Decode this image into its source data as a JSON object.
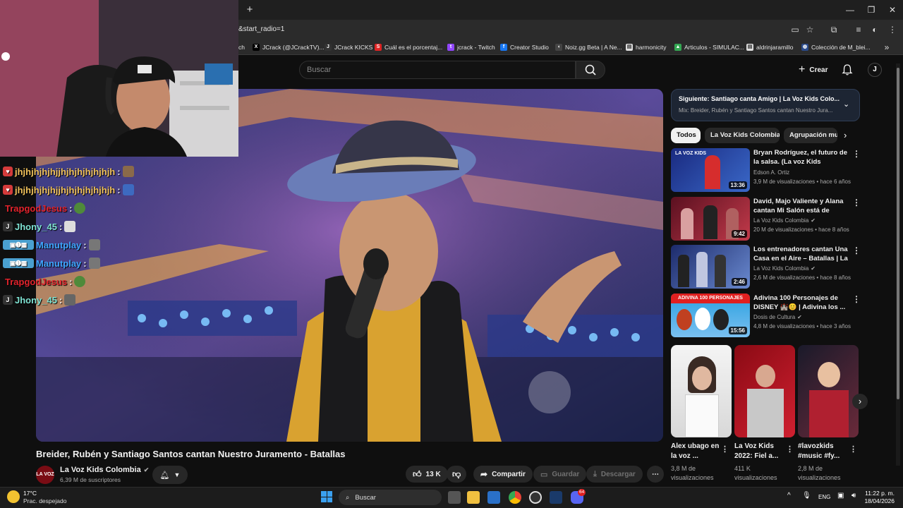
{
  "browser": {
    "url": "&start_radio=1",
    "bookmarks": [
      {
        "label": "ch",
        "icon": "twitch-icon"
      },
      {
        "label": "JCrack (@JCrackTV)...",
        "icon": "x-icon"
      },
      {
        "label": "JCrack KICKS",
        "icon": "jcrack-icon"
      },
      {
        "label": "Cuál es el porcentaj...",
        "icon": "s-icon"
      },
      {
        "label": "jcrack - Twitch",
        "icon": "twitch-icon"
      },
      {
        "label": "Creator Studio",
        "icon": "facebook-icon"
      },
      {
        "label": "Noiz.gg Beta | A Ne...",
        "icon": "noiz-icon"
      },
      {
        "label": "harmonicity",
        "icon": "page-icon"
      },
      {
        "label": "Articulos - SIMULAC...",
        "icon": "drive-icon"
      },
      {
        "label": "aldrinjaramillo",
        "icon": "page-icon"
      },
      {
        "label": "Colección de M_blei...",
        "icon": "globe-icon"
      }
    ]
  },
  "header": {
    "search_placeholder": "Buscar",
    "create_label": "Crear"
  },
  "chat": [
    {
      "user": "jhjhjhjhjhjjhjhjhjhjhjhjh",
      "suffix": ":",
      "color": "#f0c15a",
      "badge": "heart-badge-icon"
    },
    {
      "user": "jhjhjhjhjhjjhjhjhjhjhjhjh",
      "suffix": ":",
      "color": "#f0c15a",
      "badge": "heart-badge-icon"
    },
    {
      "user": "TrapgodJesus",
      "suffix": ":",
      "color": "#e3232c",
      "badge": ""
    },
    {
      "user": "Jhony_45",
      "suffix": ":",
      "color": "#7fe3d3",
      "badge": "jcrack-badge-icon"
    },
    {
      "user": "Manutplay",
      "suffix": ":",
      "color": "#3ea6ff",
      "badge": "multi-badge-icon"
    },
    {
      "user": "Manutplay",
      "suffix": ":",
      "color": "#3ea6ff",
      "badge": "multi-badge-icon"
    },
    {
      "user": "TrapgodJesus",
      "suffix": ":",
      "color": "#e3232c",
      "badge": ""
    },
    {
      "user": "Jhony_45",
      "suffix": ":",
      "color": "#7fe3d3",
      "badge": "jcrack-badge-icon"
    }
  ],
  "video": {
    "title": "Breider, Rubén y Santiago Santos cantan Nuestro Juramento - Batallas",
    "channel": "La Voz Kids Colombia",
    "channel_logo": "LA VOZ",
    "subscribers": "6,39 M de suscriptores",
    "likes": "13 K",
    "share_label": "Compartir",
    "save_label": "Guardar",
    "download_label": "Descargar"
  },
  "upnext": {
    "title": "Siguiente: Santiago canta Amigo | La Voz Kids Colo...",
    "subtitle": "Mix: Breider, Rubén y Santiago Santos cantan Nuestro Jura..."
  },
  "chips": [
    "Todos",
    "La Voz Kids Colombia",
    "Agrupación mu"
  ],
  "recommendations": [
    {
      "title": "Bryan Rodríguez, el futuro de la salsa. (La voz Kids Colombia)",
      "channel": "Edson A. Ortiz",
      "verified": false,
      "meta": "3,9 M de visualizaciones • hace 6 años",
      "duration": "13:36"
    },
    {
      "title": "David, Majo Valiente y Alana cantan Mi Salón está de Fiesta...",
      "channel": "La Voz Kids Colombia",
      "verified": true,
      "meta": "20 M de visualizaciones • hace 8 años",
      "duration": "9:42"
    },
    {
      "title": "Los entrenadores cantan Una Casa en el Aire – Batallas | La ...",
      "channel": "La Voz Kids Colombia",
      "verified": true,
      "meta": "2,6 M de visualizaciones • hace 8 años",
      "duration": "2:46"
    },
    {
      "title": "Adivina 100 Personajes de DISNEY 🏰😊 | Adivina los ...",
      "channel": "Dosis de Cultura",
      "verified": true,
      "meta": "4,8 M de visualizaciones • hace 3 años",
      "duration": "15:56",
      "thumb_text": "ADIVINA 100 PERSONAJES"
    }
  ],
  "shorts": [
    {
      "title": "Alex ubago en la voz ...",
      "views": "3,8 M de visualizaciones"
    },
    {
      "title": "La Voz Kids 2022: Fiel a...",
      "views": "411 K visualizaciones"
    },
    {
      "title": "#lavozkids #music #fy...",
      "views": "2,8 M de visualizaciones"
    }
  ],
  "taskbar": {
    "temperature": "17°C",
    "weather": "Prac. despejado",
    "search_label": "Buscar",
    "language": "ENG",
    "time": "11:22 p. m.",
    "date": "18/04/2026",
    "discord_badge": "64"
  },
  "colors": {
    "youtube_bg": "#0f0f0f",
    "accent_blue": "#3ea6ff",
    "upnext_bg": "#1d2533"
  }
}
